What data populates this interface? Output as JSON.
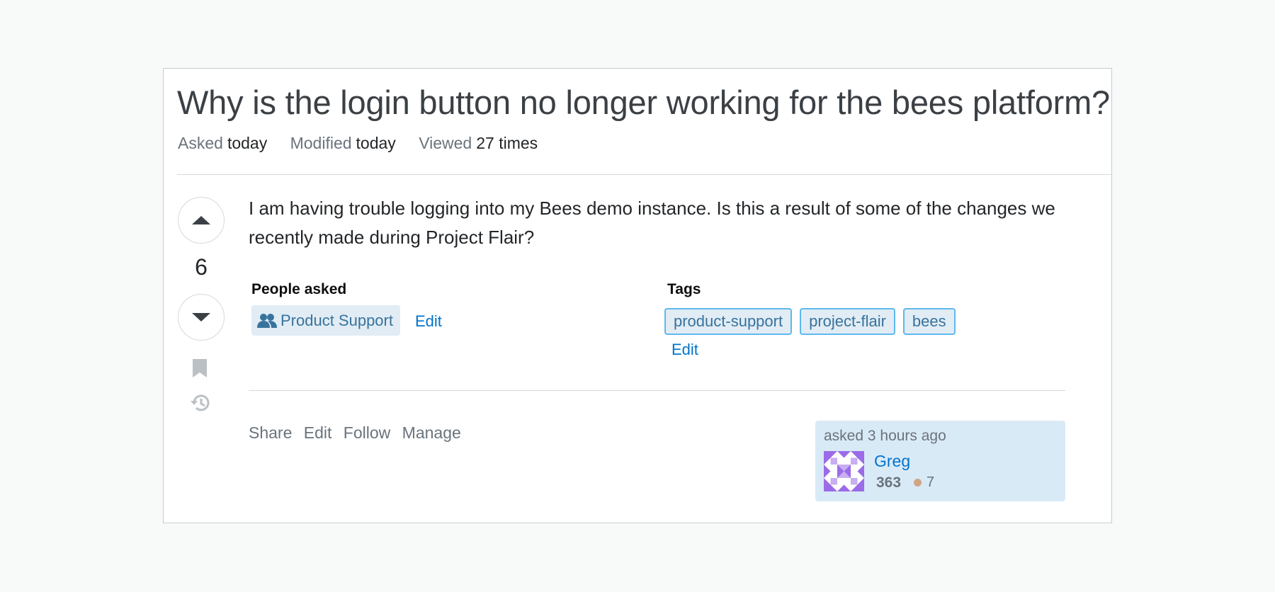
{
  "question": {
    "title": "Why is the login button no longer working for the bees platform?",
    "meta": {
      "asked_label": "Asked",
      "asked_value": "today",
      "modified_label": "Modified",
      "modified_value": "today",
      "viewed_label": "Viewed",
      "viewed_value": "27 times"
    },
    "votes": "6",
    "body": "I am having trouble logging into my Bees demo instance. Is this a result of some of the changes we recently made during Project Flair?"
  },
  "people_asked": {
    "heading": "People asked",
    "group": "Product Support",
    "edit_label": "Edit"
  },
  "tags": {
    "heading": "Tags",
    "items": [
      "product-support",
      "project-flair",
      "bees"
    ],
    "edit_label": "Edit"
  },
  "post_actions": [
    "Share",
    "Edit",
    "Follow",
    "Manage"
  ],
  "owner": {
    "asked_time": "asked 3 hours ago",
    "name": "Greg",
    "reputation": "363",
    "bronze_badges": "7"
  },
  "icons": {
    "upvote": "caret-up-icon",
    "downvote": "caret-down-icon",
    "bookmark": "bookmark-icon",
    "history": "history-icon",
    "group": "users-icon"
  },
  "colors": {
    "link": "#0074cc",
    "tag_bg": "#e1ecf4",
    "tag_border": "#5eb8ee",
    "owner_bg": "#d9eaf7",
    "bronze": "#d1a684",
    "avatar": "#9b6be8"
  }
}
